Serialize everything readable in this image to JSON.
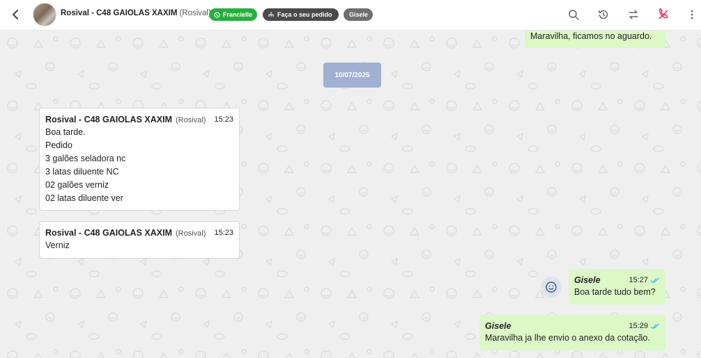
{
  "header": {
    "contact_name": "Rosival - C48 GAIOLAS XAXIM",
    "contact_alias": "(Rosival)",
    "tags": [
      {
        "label": "Francielle",
        "color": "#25b03d",
        "icon": "whatsapp-icon"
      },
      {
        "label": "Faça o seu pedido",
        "color": "#4a4a4a",
        "icon": "flow-icon"
      },
      {
        "label": "Gisele",
        "color": "#6f6f6f",
        "icon": ""
      }
    ],
    "actions": [
      "search-icon",
      "history-icon",
      "transfer-icon",
      "end-chat-icon",
      "more-icon"
    ]
  },
  "colors": {
    "chat_background": "#efefef",
    "outgoing_bubble": "#dcf8c6",
    "incoming_bubble": "#ffffff",
    "date_chip": "#9fb0d3",
    "read_ticks": "#4fb3e8",
    "end_chat_icon": "#e0245e"
  },
  "conversation": {
    "top_partial_message": "Maravilha, ficamos no aguardo.",
    "date_separator": "10/07/2025",
    "incoming": [
      {
        "sender": "Rosival - C48 GAIOLAS XAXIM",
        "alias": "(Rosival)",
        "time": "15:23",
        "lines": [
          "Boa tarde.",
          "Pedido",
          "3 galões seladora nc",
          "3 latas diluente NC",
          "02 galões verniz",
          "02 latas diluente ver"
        ]
      },
      {
        "sender": "Rosival - C48 GAIOLAS XAXIM",
        "alias": "(Rosival)",
        "time": "15:23",
        "lines": [
          "Verniz"
        ]
      }
    ],
    "outgoing": [
      {
        "sender": "Gisele",
        "time": "15:27",
        "text": "Boa tarde tudo bem?",
        "status": "read"
      },
      {
        "sender": "Gisele",
        "time": "15:29",
        "text": "Maravilha ja lhe envio o anexo da cotação.",
        "status": "read"
      }
    ]
  }
}
